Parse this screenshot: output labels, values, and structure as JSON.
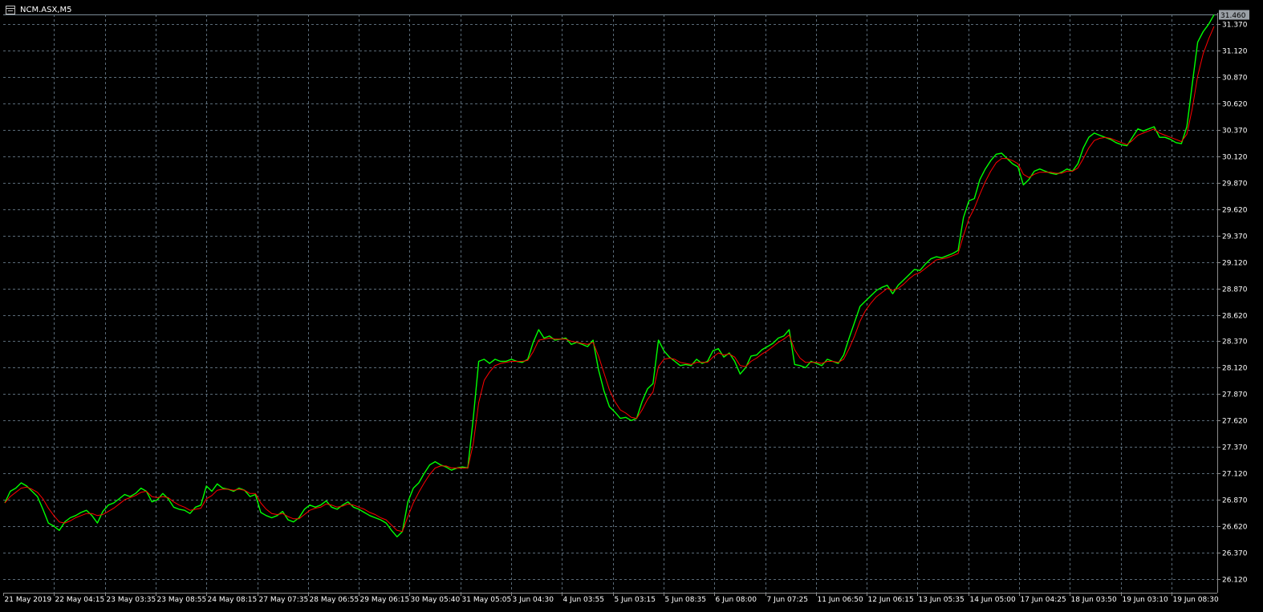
{
  "window": {
    "title": "NCM.ASX,M5",
    "icon": "chart-window-icon"
  },
  "colors": {
    "background": "#000000",
    "grid": "#5a6b78",
    "price": "#00ff00",
    "ma": "#ff0000",
    "text": "#ffffff",
    "axis": "#8c8c8c"
  },
  "chart_data": {
    "type": "line",
    "title": "NCM.ASX,M5",
    "xlabel": "",
    "ylabel": "",
    "ylim": [
      26.0,
      31.46
    ],
    "grid": true,
    "legend": "none",
    "current_price": 31.46,
    "y_ticks": [
      31.37,
      31.12,
      30.87,
      30.62,
      30.37,
      30.12,
      29.87,
      29.62,
      29.37,
      29.12,
      28.87,
      28.62,
      28.37,
      28.12,
      27.87,
      27.62,
      27.37,
      27.12,
      26.87,
      26.62,
      26.37,
      26.12
    ],
    "y_tick_labels": [
      "31.370",
      "31.120",
      "30.870",
      "30.620",
      "30.370",
      "30.120",
      "29.870",
      "29.620",
      "29.370",
      "29.120",
      "28.870",
      "28.620",
      "28.370",
      "28.120",
      "27.870",
      "27.620",
      "27.370",
      "27.120",
      "26.870",
      "26.620",
      "26.370",
      "26.120"
    ],
    "x_tick_labels": [
      "21 May 2019",
      "22 May 04:15",
      "23 May 03:35",
      "23 May 08:55",
      "24 May 08:15",
      "27 May 07:35",
      "28 May 06:55",
      "29 May 06:15",
      "30 May 05:40",
      "31 May 05:05",
      "3 Jun 04:30",
      "4 Jun 03:55",
      "5 Jun 03:15",
      "5 Jun 08:35",
      "6 Jun 08:00",
      "7 Jun 07:25",
      "11 Jun 06:50",
      "12 Jun 06:15",
      "13 Jun 05:35",
      "14 Jun 05:00",
      "17 Jun 04:25",
      "18 Jun 03:50",
      "19 Jun 03:10",
      "19 Jun 08:30"
    ],
    "series": [
      {
        "key": "price",
        "values": [
          26.84,
          26.95,
          26.98,
          27.03,
          27.0,
          26.95,
          26.9,
          26.78,
          26.65,
          26.62,
          26.58,
          26.66,
          26.7,
          26.72,
          26.75,
          26.77,
          26.72,
          26.65,
          26.76,
          26.82,
          26.84,
          26.88,
          26.92,
          26.9,
          26.93,
          26.98,
          26.95,
          26.85,
          26.87,
          26.93,
          26.88,
          26.8,
          26.78,
          26.77,
          26.74,
          26.8,
          26.82,
          27.0,
          26.95,
          27.02,
          26.98,
          26.97,
          26.95,
          26.98,
          26.96,
          26.9,
          26.92,
          26.75,
          26.72,
          26.7,
          26.72,
          26.76,
          26.68,
          26.66,
          26.7,
          26.78,
          26.82,
          26.8,
          26.82,
          26.86,
          26.8,
          26.78,
          26.82,
          26.85,
          26.8,
          26.78,
          26.75,
          26.72,
          26.7,
          26.68,
          26.65,
          26.58,
          26.52,
          26.57,
          26.85,
          26.98,
          27.03,
          27.12,
          27.2,
          27.23,
          27.2,
          27.18,
          27.15,
          27.17,
          27.18,
          27.17,
          27.64,
          28.18,
          28.2,
          28.16,
          28.2,
          28.18,
          28.18,
          28.2,
          28.18,
          28.17,
          28.2,
          28.36,
          28.48,
          28.4,
          28.42,
          28.38,
          28.39,
          28.4,
          28.34,
          28.36,
          28.34,
          28.32,
          28.38,
          28.1,
          27.9,
          27.75,
          27.7,
          27.64,
          27.65,
          27.62,
          27.64,
          27.8,
          27.92,
          27.97,
          28.38,
          28.28,
          28.22,
          28.18,
          28.14,
          28.15,
          28.14,
          28.2,
          28.16,
          28.18,
          28.28,
          28.3,
          28.22,
          28.26,
          28.18,
          28.06,
          28.12,
          28.23,
          28.24,
          28.29,
          28.32,
          28.35,
          28.4,
          28.42,
          28.48,
          28.15,
          28.14,
          28.12,
          28.18,
          28.16,
          28.14,
          28.2,
          28.18,
          28.16,
          28.24,
          28.4,
          28.55,
          28.7,
          28.75,
          28.8,
          28.85,
          28.88,
          28.9,
          28.82,
          28.9,
          28.95,
          29.0,
          29.05,
          29.04,
          29.1,
          29.15,
          29.17,
          29.16,
          29.18,
          29.2,
          29.23,
          29.54,
          29.7,
          29.72,
          29.9,
          30.0,
          30.08,
          30.14,
          30.15,
          30.1,
          30.05,
          30.02,
          29.85,
          29.9,
          29.98,
          30.0,
          29.98,
          29.96,
          29.95,
          29.97,
          30.0,
          29.98,
          30.05,
          30.2,
          30.3,
          30.34,
          30.32,
          30.3,
          30.28,
          30.25,
          30.23,
          30.22,
          30.3,
          30.38,
          30.36,
          30.38,
          30.4,
          30.3,
          30.3,
          30.28,
          30.25,
          30.24,
          30.4,
          30.8,
          31.2,
          31.3,
          31.37,
          31.46
        ]
      },
      {
        "key": "ma",
        "values": [
          26.84,
          26.9,
          26.94,
          26.98,
          26.99,
          26.97,
          26.94,
          26.88,
          26.79,
          26.72,
          26.66,
          26.65,
          26.67,
          26.7,
          26.72,
          26.74,
          26.74,
          26.72,
          26.73,
          26.76,
          26.79,
          26.83,
          26.87,
          26.89,
          26.91,
          26.94,
          26.95,
          26.9,
          26.89,
          26.9,
          26.89,
          26.85,
          26.82,
          26.8,
          26.77,
          26.78,
          26.79,
          26.88,
          26.91,
          26.96,
          26.97,
          26.97,
          26.96,
          26.97,
          26.96,
          26.93,
          26.93,
          26.84,
          26.78,
          26.74,
          26.73,
          26.74,
          26.71,
          26.69,
          26.69,
          26.73,
          26.77,
          26.79,
          26.8,
          26.83,
          26.82,
          26.8,
          26.81,
          26.83,
          26.82,
          26.8,
          26.78,
          26.75,
          26.73,
          26.7,
          26.68,
          26.63,
          26.58,
          26.57,
          26.71,
          26.84,
          26.94,
          27.03,
          27.11,
          27.17,
          27.19,
          27.19,
          27.17,
          27.17,
          27.17,
          27.17,
          27.4,
          27.79,
          28.0,
          28.08,
          28.14,
          28.16,
          28.17,
          28.18,
          28.18,
          28.18,
          28.19,
          28.27,
          28.38,
          28.39,
          28.4,
          28.39,
          28.39,
          28.39,
          28.37,
          28.36,
          28.35,
          28.34,
          28.36,
          28.23,
          28.07,
          27.91,
          27.8,
          27.72,
          27.69,
          27.65,
          27.64,
          27.72,
          27.82,
          27.89,
          28.13,
          28.2,
          28.21,
          28.2,
          28.17,
          28.16,
          28.15,
          28.17,
          28.17,
          28.17,
          28.22,
          28.26,
          28.24,
          28.25,
          28.22,
          28.14,
          28.13,
          28.18,
          28.21,
          28.25,
          28.28,
          28.32,
          28.36,
          28.39,
          28.43,
          28.29,
          28.21,
          28.17,
          28.17,
          28.17,
          28.16,
          28.18,
          28.18,
          28.17,
          28.2,
          28.3,
          28.42,
          28.56,
          28.66,
          28.73,
          28.79,
          28.83,
          28.87,
          28.85,
          28.87,
          28.91,
          28.96,
          29.0,
          29.02,
          29.06,
          29.1,
          29.14,
          29.15,
          29.16,
          29.18,
          29.2,
          29.37,
          29.53,
          29.63,
          29.76,
          29.88,
          29.98,
          30.06,
          30.1,
          30.1,
          30.08,
          30.05,
          29.95,
          29.92,
          29.95,
          29.97,
          29.97,
          29.97,
          29.96,
          29.96,
          29.98,
          29.98,
          30.01,
          30.1,
          30.2,
          30.27,
          30.29,
          30.3,
          30.29,
          30.27,
          30.25,
          30.23,
          30.27,
          30.32,
          30.34,
          30.36,
          30.38,
          30.34,
          30.32,
          30.3,
          30.28,
          30.26,
          30.33,
          30.57,
          30.88,
          31.09,
          31.23,
          31.35
        ]
      }
    ]
  }
}
